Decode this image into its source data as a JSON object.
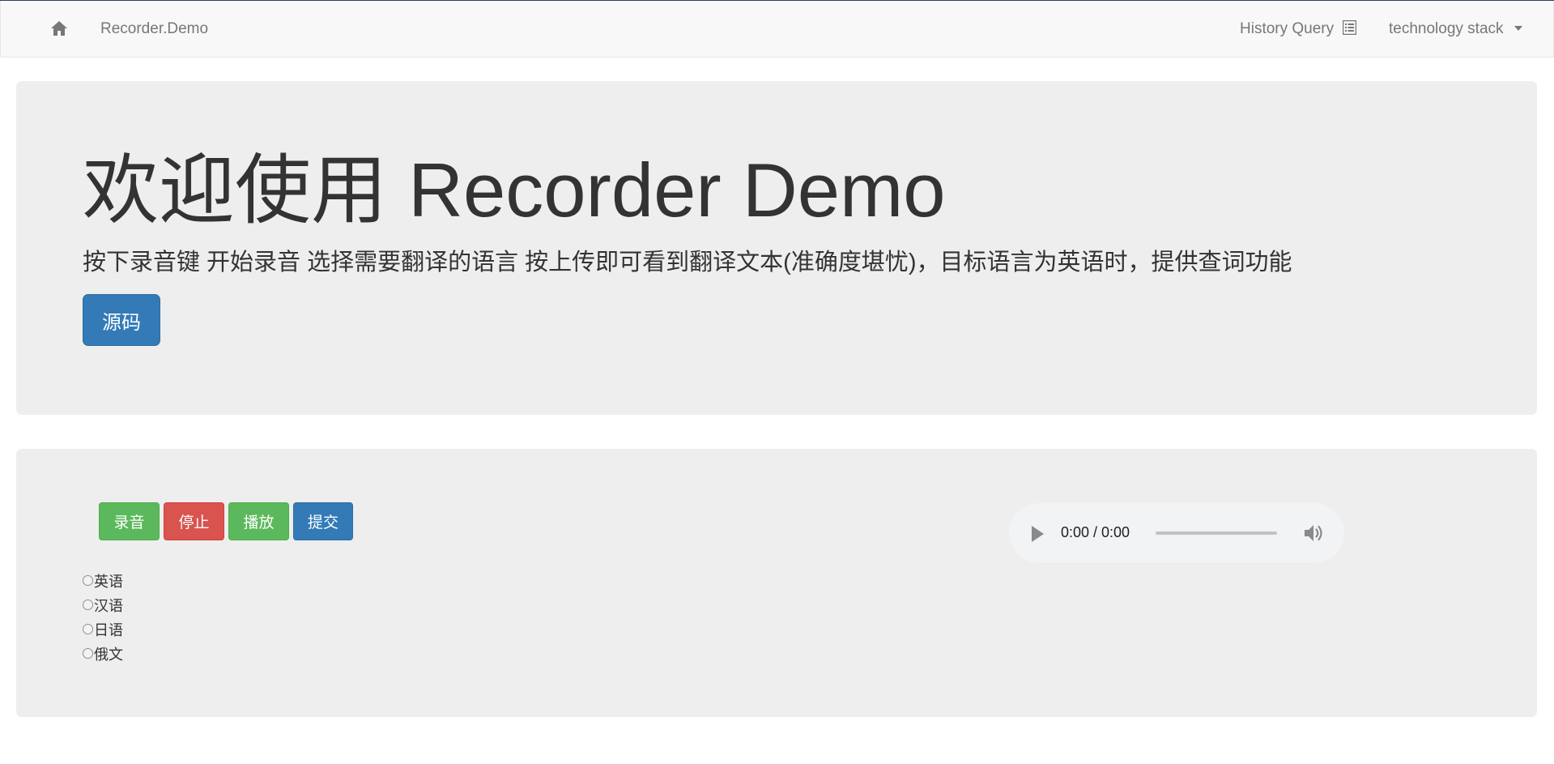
{
  "navbar": {
    "home_icon": "home-icon",
    "brand": "Recorder.Demo",
    "history_label": "History Query",
    "history_icon": "list-alt-icon",
    "tech_label": "technology stack"
  },
  "jumbotron": {
    "title": "欢迎使用 Recorder Demo",
    "lead": "按下录音键 开始录音 选择需要翻译的语言 按上传即可看到翻译文本(准确度堪忧)，目标语言为英语时，提供查词功能",
    "source_button": "源码"
  },
  "recorder": {
    "buttons": {
      "record": "录音",
      "stop": "停止",
      "play": "播放",
      "submit": "提交"
    },
    "languages": [
      "英语",
      "汉语",
      "日语",
      "俄文"
    ],
    "audio": {
      "time": "0:00 / 0:00",
      "progress": 0
    }
  },
  "colors": {
    "primary": "#337ab7",
    "success": "#5cb85c",
    "danger": "#d9534f",
    "jumbotron_bg": "#eeeeee",
    "navbar_bg": "#f8f8f8"
  }
}
